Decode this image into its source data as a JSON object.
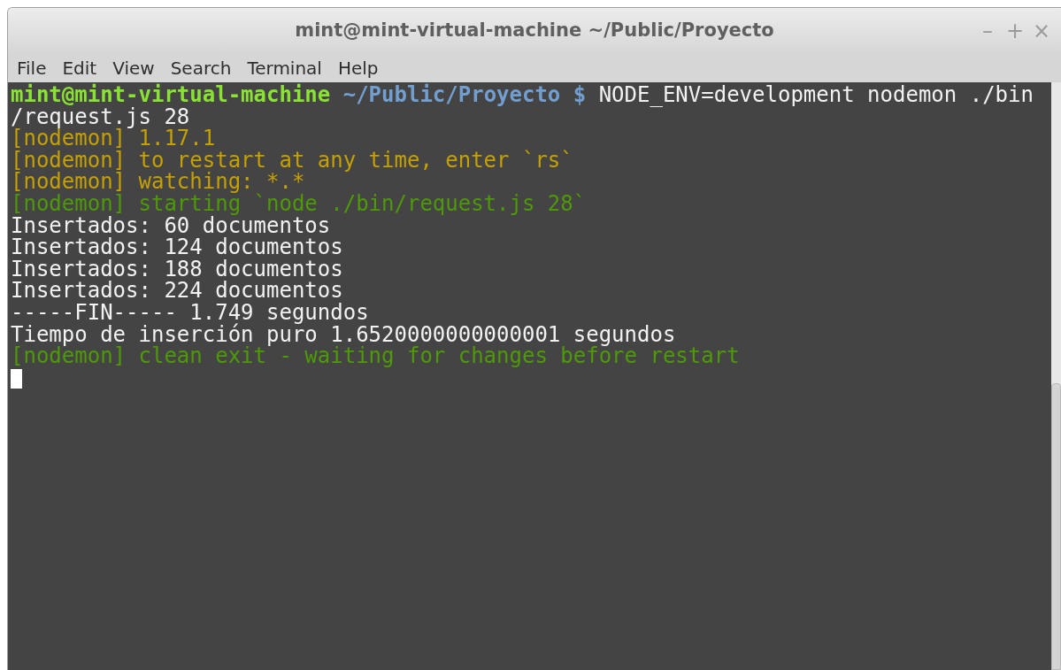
{
  "window": {
    "title": "mint@mint-virtual-machine ~/Public/Proyecto",
    "controls": [
      "–",
      "+",
      "×"
    ]
  },
  "menu": [
    "File",
    "Edit",
    "View",
    "Search",
    "Terminal",
    "Help"
  ],
  "terminal": {
    "lines": [
      {
        "segments": [
          {
            "text": "mint@mint-virtual-machine",
            "kind": "user"
          },
          {
            "text": " ~/Public/Proyecto $",
            "kind": "path"
          },
          {
            "text": " NODE_ENV=development nodemon ./bin",
            "kind": "plain"
          }
        ]
      },
      {
        "segments": [
          {
            "text": "/request.js 28",
            "kind": "plain"
          }
        ]
      },
      {
        "segments": [
          {
            "text": "[nodemon] 1.17.1",
            "kind": "warn"
          }
        ]
      },
      {
        "segments": [
          {
            "text": "[nodemon] to restart at any time, enter `rs`",
            "kind": "warn"
          }
        ]
      },
      {
        "segments": [
          {
            "text": "[nodemon] watching: *.*",
            "kind": "warn"
          }
        ]
      },
      {
        "segments": [
          {
            "text": "[nodemon] starting `node ./bin/request.js 28`",
            "kind": "info"
          }
        ]
      },
      {
        "segments": [
          {
            "text": "Insertados: 60 documentos",
            "kind": "plain"
          }
        ]
      },
      {
        "segments": [
          {
            "text": "Insertados: 124 documentos",
            "kind": "plain"
          }
        ]
      },
      {
        "segments": [
          {
            "text": "Insertados: 188 documentos",
            "kind": "plain"
          }
        ]
      },
      {
        "segments": [
          {
            "text": "Insertados: 224 documentos",
            "kind": "plain"
          }
        ]
      },
      {
        "segments": [
          {
            "text": "-----FIN----- 1.749 segundos",
            "kind": "plain"
          }
        ]
      },
      {
        "segments": [
          {
            "text": "Tiempo de inserción puro 1.6520000000000001 segundos",
            "kind": "plain"
          }
        ]
      },
      {
        "segments": [
          {
            "text": "[nodemon] clean exit - waiting for changes before restart",
            "kind": "info"
          }
        ]
      }
    ]
  }
}
